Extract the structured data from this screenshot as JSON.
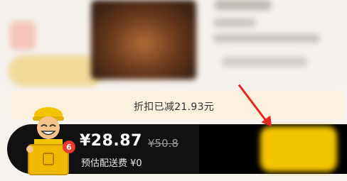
{
  "discount": {
    "label": "折扣已减21.93元"
  },
  "cart": {
    "price": "¥28.87",
    "original_price": "¥50.8",
    "delivery_fee": "预估配送费 ¥0",
    "item_count": "6"
  },
  "icons": {
    "courier": "courier-mascot-icon",
    "annotation": "red-arrow-icon"
  },
  "colors": {
    "cart_bar": "#111111",
    "checkout_button": "#f3c400",
    "badge": "#e83a2e",
    "arrow": "#e12a24",
    "discount_bar": "#fbf1dc"
  }
}
